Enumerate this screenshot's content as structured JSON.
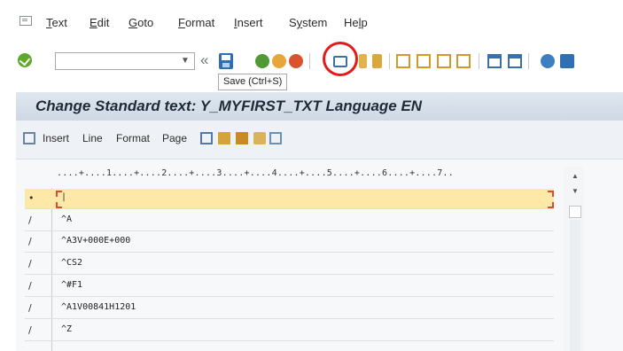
{
  "menu": {
    "items": [
      "Text",
      "Edit",
      "Goto",
      "Format",
      "Insert",
      "System",
      "Help"
    ],
    "mnemonics": [
      "T",
      "E",
      "G",
      "F",
      "I",
      "y",
      "l"
    ]
  },
  "toolbar": {
    "command_value": "",
    "save_tooltip": "Save   (Ctrl+S)",
    "icons": [
      "check-icon",
      "command-field",
      "dropdown",
      "double-chevron",
      "save-icon",
      "back-icon",
      "exit-icon",
      "cancel-icon",
      "print-icon",
      "find-icon",
      "find-next-icon",
      "first-page-icon",
      "prev-page-icon",
      "next-page-icon",
      "last-page-icon",
      "create-session-icon",
      "shortcut-icon",
      "help-icon",
      "customize-layout-icon"
    ]
  },
  "title": "Change Standard text: Y_MYFIRST_TXT Language EN",
  "app_toolbar": {
    "items": [
      "Insert",
      "Line",
      "Format",
      "Page"
    ]
  },
  "editor": {
    "ruler": "....+....1....+....2....+....3....+....4....+....5....+....6....+....7..",
    "lines": [
      {
        "mark": "•",
        "text": "|"
      },
      {
        "mark": "/",
        "text": "^A"
      },
      {
        "mark": "/",
        "text": "^A3V+000E+000"
      },
      {
        "mark": "/",
        "text": "^CS2"
      },
      {
        "mark": "/",
        "text": "^#F1"
      },
      {
        "mark": "/",
        "text": "^A1V00841H1201"
      },
      {
        "mark": "/",
        "text": "^Z"
      }
    ]
  },
  "colors": {
    "title_band": "#d6dfe9",
    "current_line": "#fde8a8",
    "highlight_circle": "#e11b1b",
    "save_blue": "#2d6fb5",
    "ok_green": "#5fa82c"
  }
}
